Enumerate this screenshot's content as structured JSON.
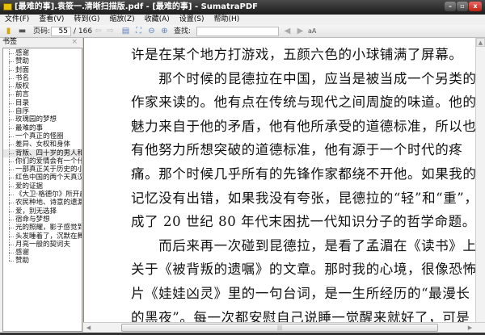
{
  "window": {
    "title": "[最难的事].袁筱一.清晰扫描版.pdf - [最难的事] - SumatraPDF",
    "controls": [
      "–",
      "▫",
      "x"
    ]
  },
  "menu": [
    "文件(F)",
    "查看(V)",
    "转到(G)",
    "缩放(Z)",
    "收藏(A)",
    "设置(S)",
    "帮助(H)"
  ],
  "toolbar": {
    "page_label": "页码:",
    "page_value": "55",
    "page_total": "/ 166",
    "find_label": "查找:",
    "find_value": "",
    "match_case": "aA"
  },
  "sidebar": {
    "title": "书签",
    "close": "×",
    "items": [
      "感谢",
      "赞助",
      "封面",
      "书名",
      "版权",
      "前言",
      "目录",
      "自序",
      "玫瑰园的梦想",
      "最难的事",
      "一个真正的怪圈",
      "差异、女权和身体",
      "背叛、四十岁的男人和死亡",
      "你们的爱情会有一个什么样的结局",
      "一部真正关于历史的小说",
      "红色中国的两个天真汉",
      "爱的证据",
      "《大卫·格德尔》所开启的",
      "农民种地、诗意的遗漏",
      "爱，别无选择",
      "宿命与梦想",
      "光的照耀，影子感觉到了",
      "头发睡着了，沉默在舞蹈",
      "月亮一般的契诃夫",
      "感谢",
      "赞助"
    ],
    "selected": 12
  },
  "document": {
    "lines": [
      "许是在某个地方打游戏，五颜六色的小球铺满了屏幕。",
      "　　那个时候的昆德拉在中国，应当是被当成一个另类的",
      "作家来读的。他有点在传统与现代之间周旋的味道。他的",
      "魅力来自于他的矛盾，他有他所承受的道德标准，所以也",
      "有他努力所想突破的道德标准，他有源于一个时代的疼",
      "痛。那个时候几乎所有的先锋作家都绕不开他。如果我的",
      "记忆没有出错，如果我没有夸张，昆德拉的“轻”和“重”，",
      "成了 20 世纪 80 年代末困扰一代知识分子的哲学命题。",
      "　　而后来再一次碰到昆德拉，是看了孟湄在《读书》上",
      "关于《被背叛的遗嘱》的文章。那时我的心境，很像恐怖",
      "片《娃娃凶灵》里的一句台词，是一生所经历的“最漫长",
      "的黑夜”。每一次都安慰自己说睡一觉醒来就好了，可是"
    ]
  }
}
